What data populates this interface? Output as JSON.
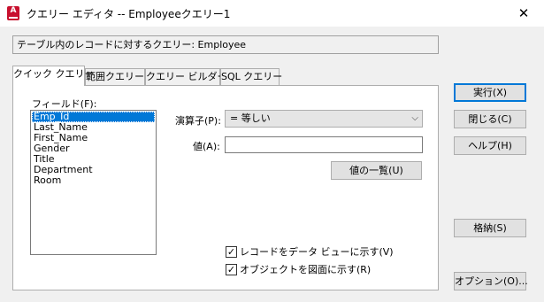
{
  "window": {
    "title": "クエリー エディタ -- Employeeクエリー1",
    "app_icon_text": "A",
    "close_glyph": "✕"
  },
  "description": "テーブル内のレコードに対するクエリー: Employee",
  "tabs": [
    {
      "label": "クイック クエリー",
      "active": true
    },
    {
      "label": "範囲クエリー",
      "active": false
    },
    {
      "label": "クエリー ビルダー",
      "active": false
    },
    {
      "label": "SQL クエリー",
      "active": false
    }
  ],
  "quick_query": {
    "field_label": "フィールド(F):",
    "fields": [
      "Emp_Id",
      "Last_Name",
      "First_Name",
      "Gender",
      "Title",
      "Department",
      "Room"
    ],
    "selected_field": "Emp_Id",
    "operator_label": "演算子(P):",
    "operator_value": "=   等しい",
    "operator_arrow": "⌵",
    "value_label": "値(A):",
    "value_input": "",
    "value_list_button": "値の一覧(U)",
    "checkbox_show_records": {
      "label": "レコードをデータ ビューに示す(V)",
      "checked": true
    },
    "checkbox_show_objects": {
      "label": "オブジェクトを図面に示す(R)",
      "checked": true
    }
  },
  "buttons": {
    "execute": "実行(X)",
    "close": "閉じる(C)",
    "help": "ヘルプ(H)",
    "store": "格納(S)",
    "options": "オプション(O)..."
  },
  "check_glyph": "✓"
}
